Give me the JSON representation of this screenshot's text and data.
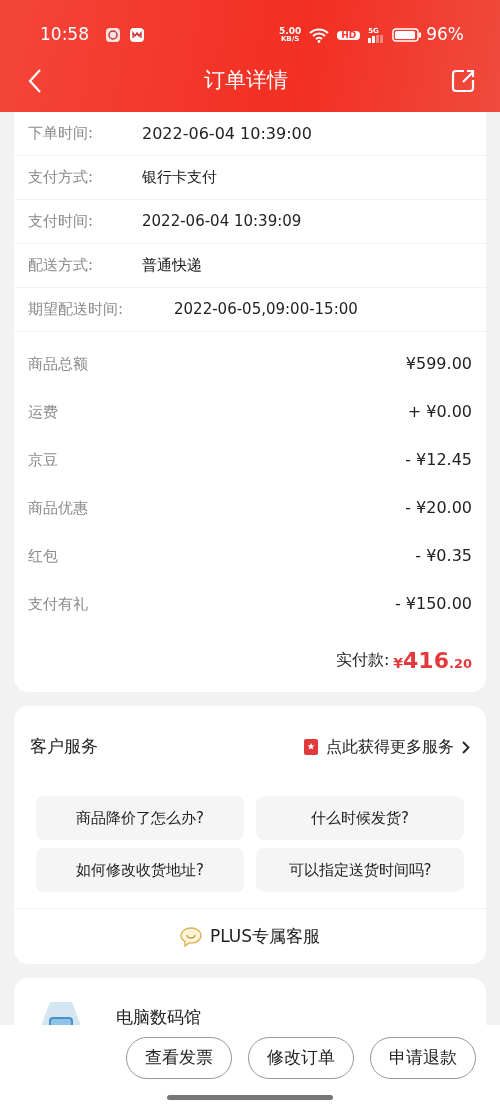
{
  "status_bar": {
    "time": "10:58",
    "net_speed": "5.00",
    "net_unit": "KB/S",
    "hd": "HD",
    "network": "5G",
    "battery": "96%"
  },
  "header": {
    "title": "订单详情"
  },
  "order_info": [
    {
      "label": "下单时间:",
      "value": "2022-06-04 10:39:00",
      "kind": "strong"
    },
    {
      "label": "支付方式:",
      "value": "银行卡支付",
      "kind": "plain"
    },
    {
      "label": "支付时间:",
      "value": "2022-06-04 10:39:09",
      "kind": "plain"
    },
    {
      "label": "配送方式:",
      "value": "普通快递",
      "kind": "plain"
    },
    {
      "label": "期望配送时间:",
      "value": "2022-06-05,09:00-15:00",
      "kind": "wide"
    }
  ],
  "amounts": [
    {
      "label": "商品总额",
      "value": "¥599.00"
    },
    {
      "label": "运费",
      "value": "+ ¥0.00"
    },
    {
      "label": "京豆",
      "value": "- ¥12.45"
    },
    {
      "label": "商品优惠",
      "value": "- ¥20.00"
    },
    {
      "label": "红包",
      "value": "- ¥0.35"
    },
    {
      "label": "支付有礼",
      "value": "- ¥150.00"
    }
  ],
  "total": {
    "label": "实付款:",
    "currency": "¥",
    "integer": "416",
    "decimal": ".20"
  },
  "customer_service": {
    "title": "客户服务",
    "more_link": "点此获得更多服务",
    "questions": [
      "商品降价了怎么办?",
      "什么时候发货?",
      "如何修改收货地址?",
      "可以指定送货时间吗?"
    ],
    "plus_service": "PLUS专属客服"
  },
  "store": {
    "name": "电脑数码馆"
  },
  "bottom_buttons": [
    "查看发票",
    "修改订单",
    "申请退款"
  ]
}
